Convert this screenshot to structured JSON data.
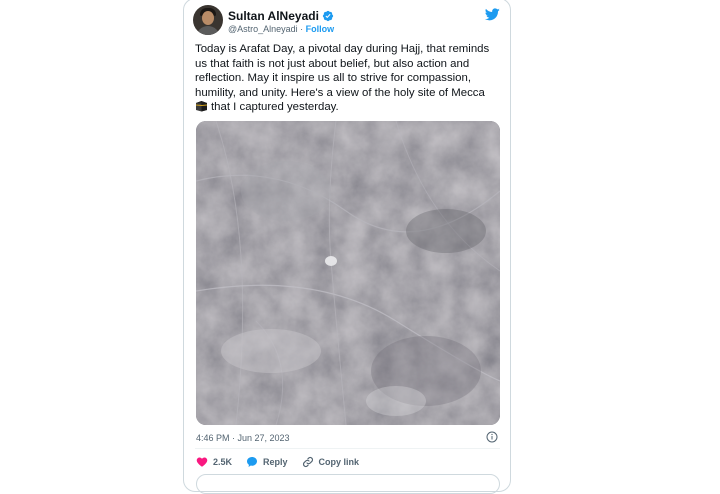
{
  "author": {
    "display_name": "Sultan AlNeyadi",
    "handle": "@Astro_Alneyadi",
    "separator": " · ",
    "follow_label": "Follow",
    "verified": true
  },
  "tweet": {
    "text_main": "Today is Arafat Day, a pivotal day during Hajj, that reminds us that faith is not just about belief, but also action and reflection. May it inspire us all to strive for compassion, humility, and unity. Here's a view of the holy site of Mecca",
    "text_tail": "that I captured yesterday.",
    "emoji_icon": "kaaba-icon",
    "timestamp": "4:46 PM · Jun 27, 2023"
  },
  "actions": {
    "like_count": "2.5K",
    "reply_label": "Reply",
    "copy_link_label": "Copy link"
  },
  "colors": {
    "accent": "#1d9bf0",
    "like": "#f91880",
    "text": "#0f1419",
    "secondary_text": "#536471",
    "border": "#cfd9de"
  },
  "icons": {
    "brand": "twitter-bird-icon",
    "verified": "verified-badge-icon",
    "info": "info-icon",
    "like": "heart-icon",
    "reply": "reply-bubble-icon",
    "copy_link": "link-icon"
  }
}
